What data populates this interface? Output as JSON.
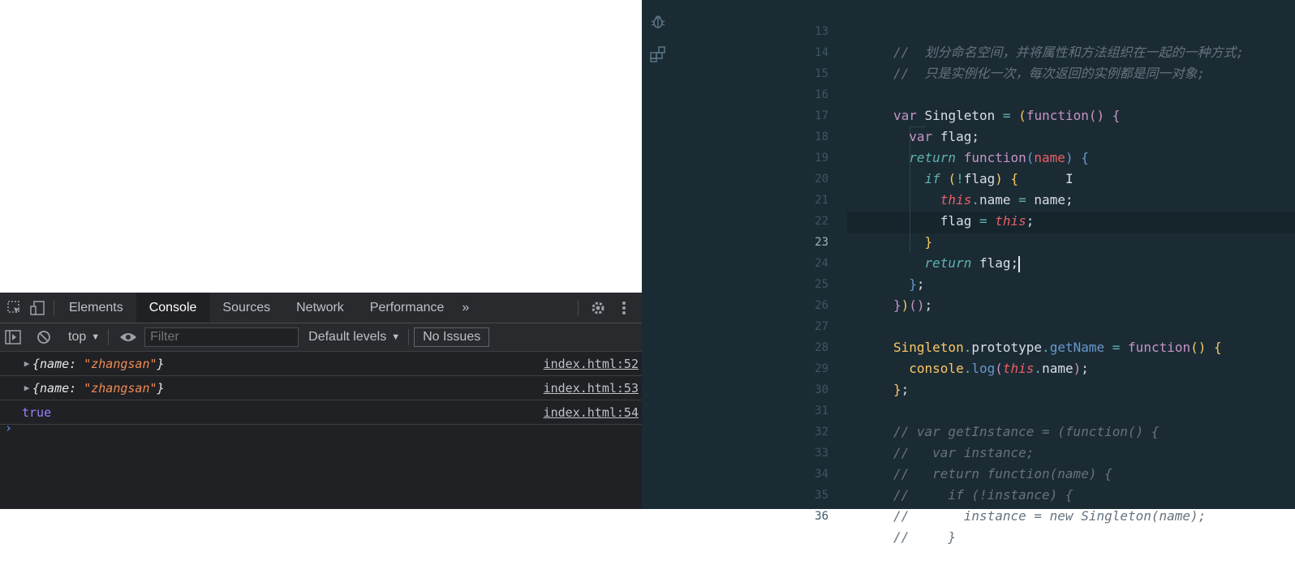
{
  "devtools": {
    "tabs": [
      "Elements",
      "Console",
      "Sources",
      "Network",
      "Performance"
    ],
    "active_tab": "Console",
    "more_tabs": "»",
    "toolbar": {
      "context": "top",
      "filter_placeholder": "Filter",
      "levels": "Default levels",
      "issues": "No Issues"
    },
    "console": {
      "rows": [
        {
          "key": "name",
          "value": "\"zhangsan\"",
          "source": "index.html:52"
        },
        {
          "key": "name",
          "value": "\"zhangsan\"",
          "source": "index.html:53"
        }
      ],
      "bool_row": {
        "value": "true",
        "source": "index.html:54"
      },
      "prompt": "›"
    }
  },
  "editor": {
    "line_numbers": [
      "13",
      "14",
      "15",
      "16",
      "17",
      "18",
      "19",
      "20",
      "21",
      "22",
      "23",
      "24",
      "25",
      "26",
      "27",
      "28",
      "29",
      "30",
      "31",
      "32",
      "33",
      "34",
      "35",
      "36"
    ],
    "comments": {
      "l13": "//  划分命名空间，并将属性和方法组织在一起的一种方式;",
      "l14": "//  只是实例化一次，每次返回的实例都是同一对象;",
      "l31": "// var getInstance = (function() {",
      "l32": "//   var instance;",
      "l33": "//   return function(name) {",
      "l34": "//     if (!instance) {",
      "l35": "//       instance = new Singleton(name);",
      "l36": "//     }"
    },
    "tokens": {
      "var": "var",
      "singleton": "Singleton",
      "eq": "=",
      "function": "function",
      "flag": "flag",
      "return": "return",
      "name": "name",
      "if": "if",
      "this": "this",
      "prototype": "prototype",
      "getName": "getName",
      "console": "console",
      "log": "log"
    }
  }
}
